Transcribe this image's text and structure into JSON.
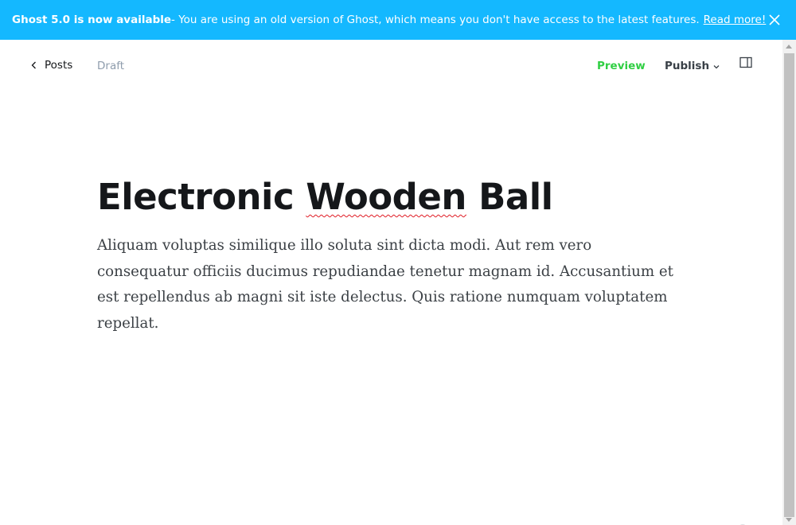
{
  "banner": {
    "title": "Ghost 5.0 is now available",
    "message": " - You are using an old version of Ghost, which means you don't have access to the latest features.",
    "link": "Read more!",
    "close_icon": "close-icon",
    "background_color": "#14b8ff"
  },
  "topbar": {
    "back_label": "Posts",
    "back_icon": "chevron-left-icon",
    "status": "Draft",
    "preview_label": "Preview",
    "publish_label": "Publish",
    "publish_icon": "chevron-down-icon",
    "sidebar_icon": "sidebar-toggle-icon",
    "preview_color": "#30cf43"
  },
  "editor": {
    "title_part1": "Electronic ",
    "title_misspelled": "Wooden",
    "title_part2": " Ball",
    "body": "Aliquam voluptas similique illo soluta sint dicta modi. Aut rem vero consequatur officiis ducimus repudiandae tenetur magnam id. Accusantium et est repellendus ab magni sit iste delectus. Quis ratione numquam voluptatem repellat."
  }
}
